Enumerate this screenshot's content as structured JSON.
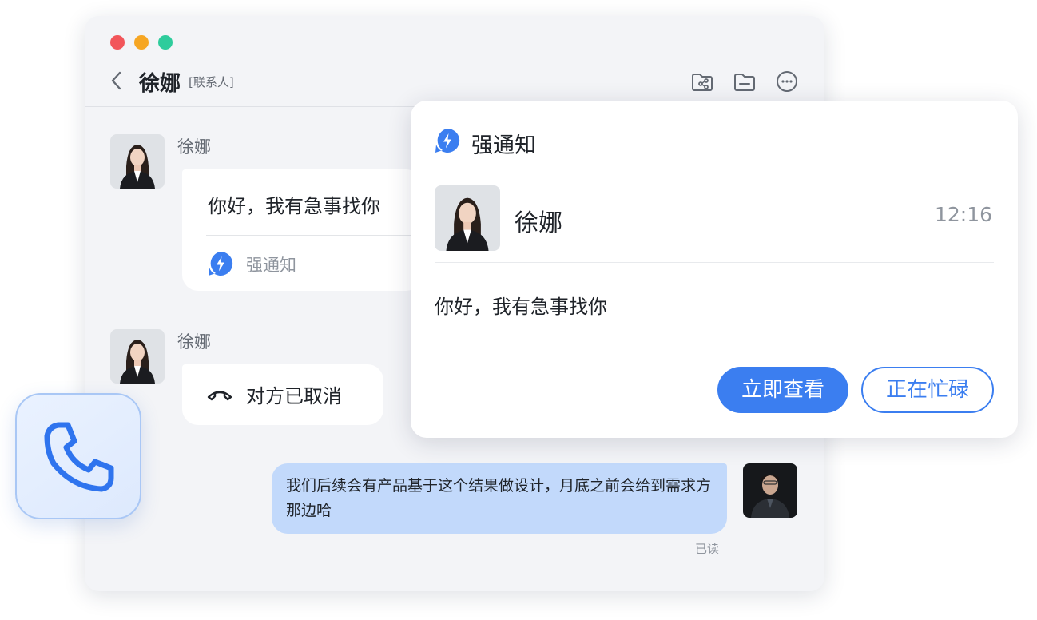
{
  "chat": {
    "title": "徐娜",
    "tag": "[联系人]"
  },
  "messages": [
    {
      "sender": "徐娜",
      "text": "你好，我有急事找你",
      "notice_label": "强通知"
    },
    {
      "sender": "徐娜",
      "text": "对方已取消"
    },
    {
      "text": "我们后续会有产品基于这个结果做设计，月底之前会给到需求方那边哈",
      "status": "已读"
    }
  ],
  "notification": {
    "title": "强通知",
    "sender": "徐娜",
    "time": "12:16",
    "message": "你好，我有急事找你",
    "primary_button": "立即查看",
    "secondary_button": "正在忙碌"
  },
  "colors": {
    "accent": "#3b7ef0",
    "my_bubble": "#c2d9fb",
    "window_bg": "#f3f4f7"
  },
  "icons": [
    "back-icon",
    "share-folder-icon",
    "folder-icon",
    "more-icon",
    "lightning-notice-icon",
    "hangup-icon",
    "phone-icon"
  ]
}
